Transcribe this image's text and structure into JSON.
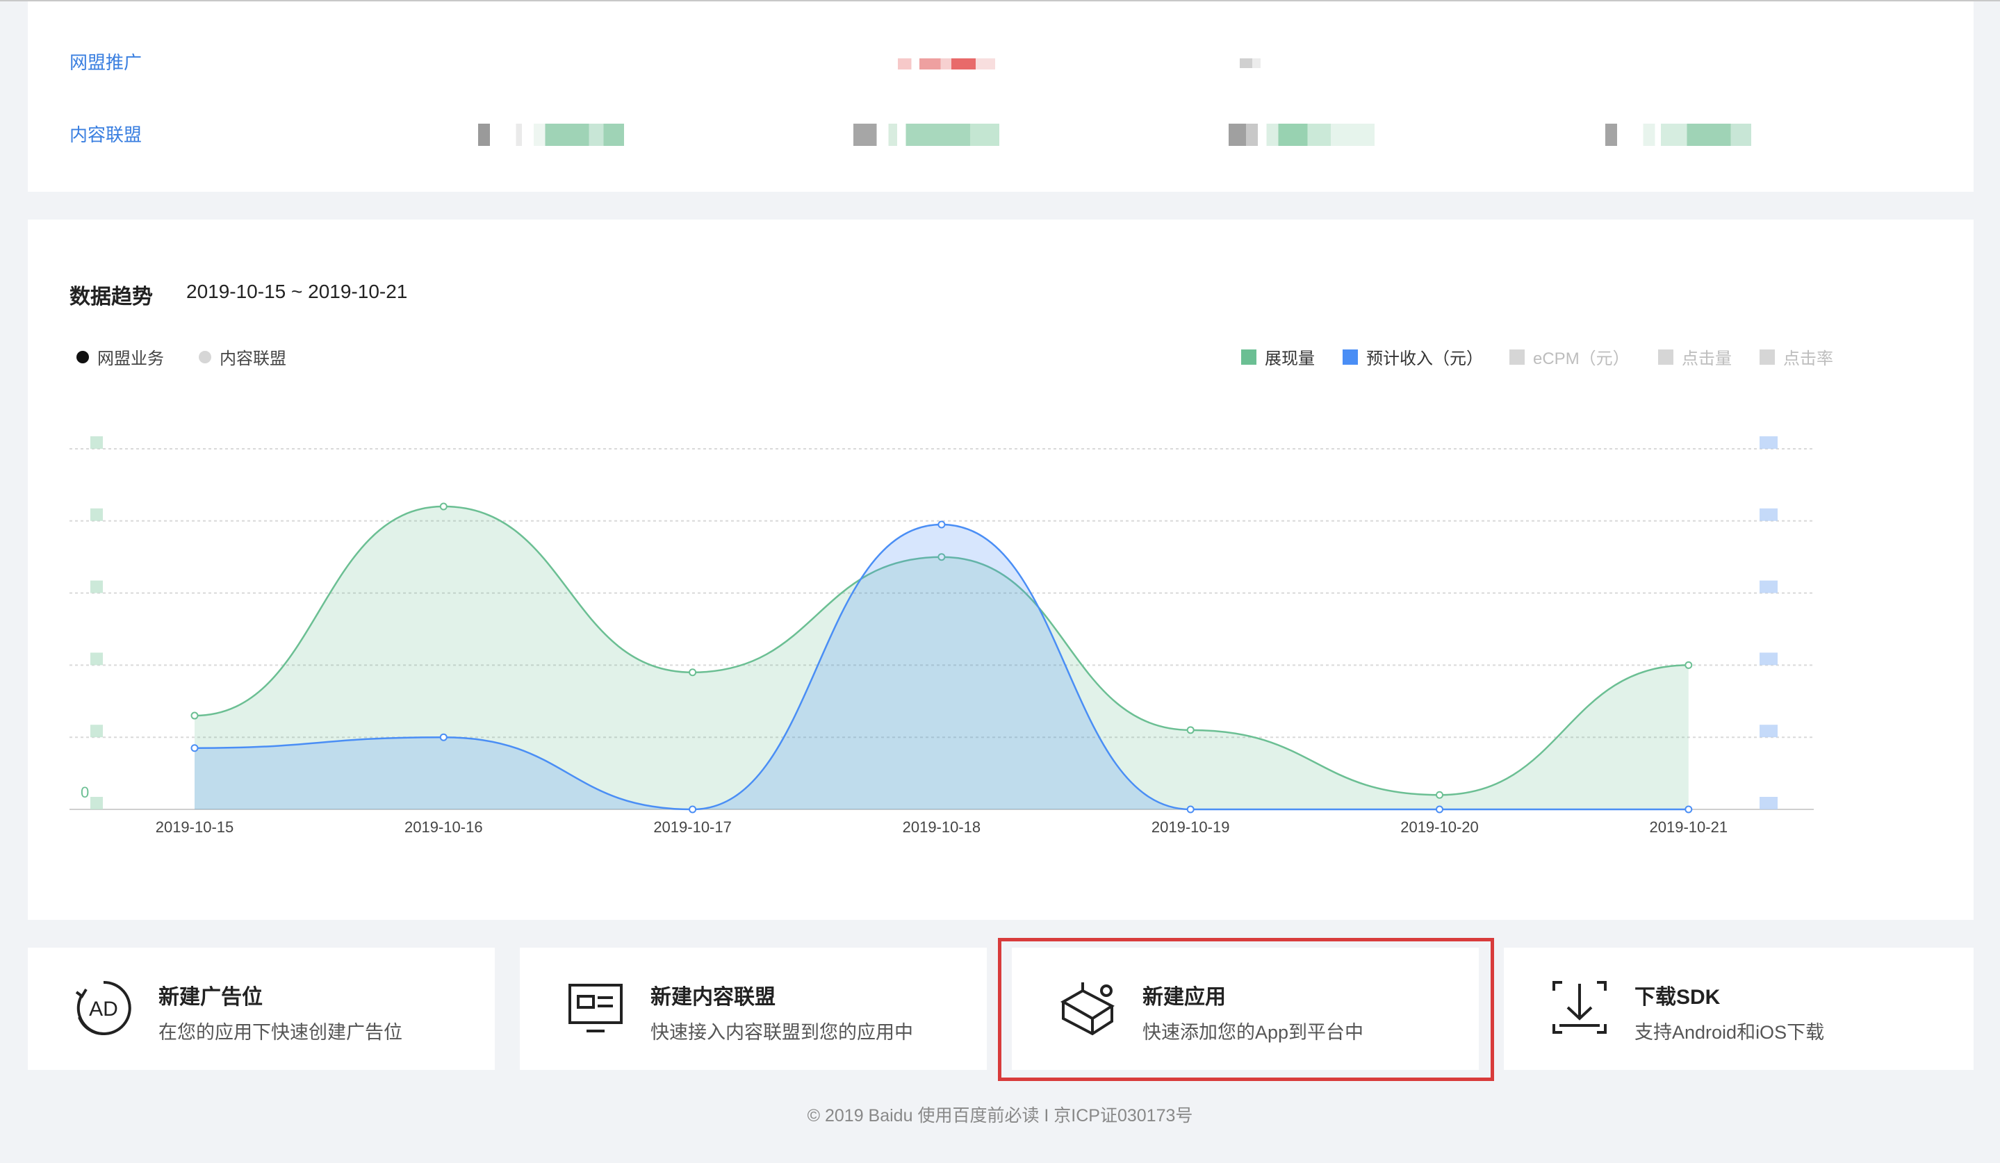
{
  "products": {
    "rows": [
      {
        "label": "网盟推广"
      },
      {
        "label": "内容联盟"
      }
    ]
  },
  "trend": {
    "title": "数据趋势",
    "range": "2019-10-15 ~ 2019-10-21",
    "biz_options": [
      {
        "label": "网盟业务",
        "selected": true
      },
      {
        "label": "内容联盟",
        "selected": false
      }
    ],
    "metrics": [
      {
        "label": "展现量",
        "color": "#6bbf93",
        "active": true
      },
      {
        "label": "预计收入（元）",
        "color": "#4a8ef5",
        "active": true
      },
      {
        "label": "eCPM（元）",
        "color": "#d6d6d6",
        "active": false
      },
      {
        "label": "点击量",
        "color": "#d6d6d6",
        "active": false
      },
      {
        "label": "点击率",
        "color": "#d6d6d6",
        "active": false
      }
    ],
    "zero_label": "0"
  },
  "chart_data": {
    "type": "area",
    "categories": [
      "2019-10-15",
      "2019-10-16",
      "2019-10-17",
      "2019-10-18",
      "2019-10-19",
      "2019-10-20",
      "2019-10-21"
    ],
    "series": [
      {
        "name": "展现量",
        "color": "#6bbf93",
        "axis": "left",
        "values": [
          0.26,
          0.84,
          0.38,
          0.7,
          0.22,
          0.04,
          0.4
        ]
      },
      {
        "name": "预计收入（元）",
        "color": "#4a8ef5",
        "axis": "right",
        "values": [
          0.17,
          0.2,
          0.0,
          0.79,
          0.0,
          0.0,
          0.0
        ]
      }
    ],
    "y_gridlines": 5,
    "grid": true,
    "legend": "top-right",
    "note": "Axis tick values are blurred in the original; values are relative to each axis maximum."
  },
  "cards": [
    {
      "title": "新建广告位",
      "desc": "在您的应用下快速创建广告位",
      "icon": "ad-icon"
    },
    {
      "title": "新建内容联盟",
      "desc": "快速接入内容联盟到您的应用中",
      "icon": "monitor-icon"
    },
    {
      "title": "新建应用",
      "desc": "快速添加您的App到平台中",
      "icon": "cube-icon"
    },
    {
      "title": "下载SDK",
      "desc": "支持Android和iOS下载",
      "icon": "download-icon"
    }
  ],
  "footer": "©  2019 Baidu  使用百度前必读 I 京ICP证030173号"
}
